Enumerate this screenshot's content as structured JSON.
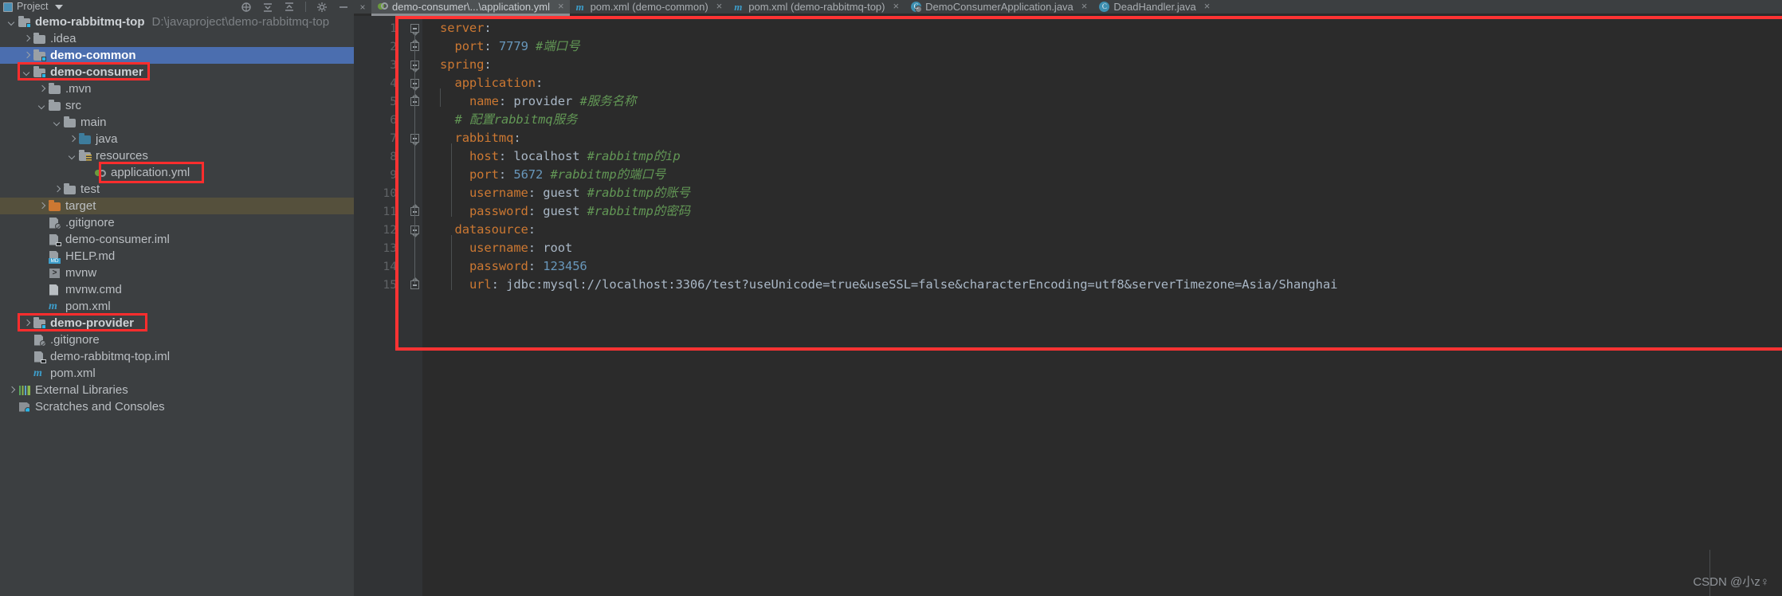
{
  "project_panel": {
    "title": "Project",
    "toolbar_icons": [
      "locate-icon",
      "collapse-all-icon",
      "expand-all-icon",
      "gear-icon",
      "minimize-icon"
    ],
    "tree": [
      {
        "label": "demo-rabbitmq-top",
        "path": "D:\\javaproject\\demo-rabbitmq-top",
        "icon": "module-folder-icon",
        "arrow": "down",
        "indent": 0,
        "bold": true
      },
      {
        "label": ".idea",
        "icon": "folder-icon",
        "arrow": "right",
        "indent": 1
      },
      {
        "label": "demo-common",
        "icon": "module-folder-icon",
        "arrow": "right",
        "indent": 1,
        "bold": true,
        "selected": true
      },
      {
        "label": "demo-consumer",
        "icon": "module-folder-icon",
        "arrow": "down",
        "indent": 1,
        "bold": true,
        "highlight": true
      },
      {
        "label": ".mvn",
        "icon": "folder-icon",
        "arrow": "right",
        "indent": 2
      },
      {
        "label": "src",
        "icon": "folder-icon",
        "arrow": "down",
        "indent": 2
      },
      {
        "label": "main",
        "icon": "folder-icon",
        "arrow": "down",
        "indent": 3
      },
      {
        "label": "java",
        "icon": "source-folder-icon",
        "arrow": "right",
        "indent": 4
      },
      {
        "label": "resources",
        "icon": "resource-folder-icon",
        "arrow": "down",
        "indent": 4
      },
      {
        "label": "application.yml",
        "icon": "yaml-file-icon",
        "arrow": "none",
        "indent": 5,
        "highlight": true
      },
      {
        "label": "test",
        "icon": "folder-icon",
        "arrow": "right",
        "indent": 3
      },
      {
        "label": "target",
        "icon": "excluded-folder-icon",
        "arrow": "right",
        "indent": 2,
        "target_row": true
      },
      {
        "label": ".gitignore",
        "icon": "gitignore-file-icon",
        "arrow": "none",
        "indent": 2
      },
      {
        "label": "demo-consumer.iml",
        "icon": "iml-file-icon",
        "arrow": "none",
        "indent": 2
      },
      {
        "label": "HELP.md",
        "icon": "markdown-file-icon",
        "arrow": "none",
        "indent": 2
      },
      {
        "label": "mvnw",
        "icon": "shell-script-icon",
        "arrow": "none",
        "indent": 2
      },
      {
        "label": "mvnw.cmd",
        "icon": "cmd-file-icon",
        "arrow": "none",
        "indent": 2
      },
      {
        "label": "pom.xml",
        "icon": "maven-file-icon",
        "arrow": "none",
        "indent": 2
      },
      {
        "label": "demo-provider",
        "icon": "module-folder-icon",
        "arrow": "right",
        "indent": 1,
        "bold": true,
        "highlight": true
      },
      {
        "label": ".gitignore",
        "icon": "gitignore-file-icon",
        "arrow": "none",
        "indent": 1
      },
      {
        "label": "demo-rabbitmq-top.iml",
        "icon": "iml-file-icon",
        "arrow": "none",
        "indent": 1
      },
      {
        "label": "pom.xml",
        "icon": "maven-file-icon",
        "arrow": "none",
        "indent": 1
      },
      {
        "label": "External Libraries",
        "icon": "external-libraries-icon",
        "arrow": "right",
        "indent": 0
      },
      {
        "label": "Scratches and Consoles",
        "icon": "scratches-icon",
        "arrow": "none",
        "indent": 0
      }
    ]
  },
  "editor": {
    "tabs": [
      {
        "label": "demo-consumer\\...\\application.yml",
        "icon": "yaml-file-icon",
        "active": true,
        "close": "×"
      },
      {
        "label": "pom.xml (demo-common)",
        "icon": "maven-file-icon",
        "active": false,
        "close": "×"
      },
      {
        "label": "pom.xml (demo-rabbitmq-top)",
        "icon": "maven-file-icon",
        "active": false,
        "close": "×"
      },
      {
        "label": "DemoConsumerApplication.java",
        "icon": "java-runnable-icon",
        "active": false,
        "close": "×"
      },
      {
        "label": "DeadHandler.java",
        "icon": "java-class-icon",
        "active": false,
        "close": "×"
      }
    ],
    "tab_close_left": "×",
    "line_numbers": [
      "1",
      "2",
      "3",
      "4",
      "5",
      "6",
      "7",
      "8",
      "9",
      "10",
      "11",
      "12",
      "13",
      "14",
      "15"
    ],
    "code_lines": [
      {
        "n": 1,
        "tokens": [
          {
            "t": "server",
            "c": "k"
          },
          {
            "t": ":",
            "c": "p"
          }
        ]
      },
      {
        "n": 2,
        "tokens": [
          {
            "t": "  ",
            "c": "p"
          },
          {
            "t": "port",
            "c": "k"
          },
          {
            "t": ": ",
            "c": "p"
          },
          {
            "t": "7779",
            "c": "n"
          },
          {
            "t": " ",
            "c": "p"
          },
          {
            "t": "#端口号",
            "c": "c"
          }
        ]
      },
      {
        "n": 3,
        "tokens": [
          {
            "t": "spring",
            "c": "k"
          },
          {
            "t": ":",
            "c": "p"
          }
        ]
      },
      {
        "n": 4,
        "tokens": [
          {
            "t": "  ",
            "c": "p"
          },
          {
            "t": "application",
            "c": "k"
          },
          {
            "t": ":",
            "c": "p"
          }
        ]
      },
      {
        "n": 5,
        "tokens": [
          {
            "t": "    ",
            "c": "p"
          },
          {
            "t": "name",
            "c": "k"
          },
          {
            "t": ": ",
            "c": "p"
          },
          {
            "t": "provider",
            "c": "p"
          },
          {
            "t": " ",
            "c": "p"
          },
          {
            "t": "#服务名称",
            "c": "c"
          }
        ]
      },
      {
        "n": 6,
        "tokens": [
          {
            "t": "  ",
            "c": "p"
          },
          {
            "t": "# 配置rabbitmq服务",
            "c": "c"
          }
        ]
      },
      {
        "n": 7,
        "tokens": [
          {
            "t": "  ",
            "c": "p"
          },
          {
            "t": "rabbitmq",
            "c": "k"
          },
          {
            "t": ":",
            "c": "p"
          }
        ]
      },
      {
        "n": 8,
        "tokens": [
          {
            "t": "    ",
            "c": "p"
          },
          {
            "t": "host",
            "c": "k"
          },
          {
            "t": ": ",
            "c": "p"
          },
          {
            "t": "localhost",
            "c": "p"
          },
          {
            "t": " ",
            "c": "p"
          },
          {
            "t": "#rabbitmp的ip",
            "c": "c"
          }
        ]
      },
      {
        "n": 9,
        "tokens": [
          {
            "t": "    ",
            "c": "p"
          },
          {
            "t": "port",
            "c": "k"
          },
          {
            "t": ": ",
            "c": "p"
          },
          {
            "t": "5672",
            "c": "n"
          },
          {
            "t": " ",
            "c": "p"
          },
          {
            "t": "#rabbitmp的端口号",
            "c": "c"
          }
        ]
      },
      {
        "n": 10,
        "tokens": [
          {
            "t": "    ",
            "c": "p"
          },
          {
            "t": "username",
            "c": "k"
          },
          {
            "t": ": ",
            "c": "p"
          },
          {
            "t": "guest",
            "c": "p"
          },
          {
            "t": " ",
            "c": "p"
          },
          {
            "t": "#rabbitmp的账号",
            "c": "c"
          }
        ]
      },
      {
        "n": 11,
        "tokens": [
          {
            "t": "    ",
            "c": "p"
          },
          {
            "t": "password",
            "c": "k"
          },
          {
            "t": ": ",
            "c": "p"
          },
          {
            "t": "guest",
            "c": "p"
          },
          {
            "t": " ",
            "c": "p"
          },
          {
            "t": "#rabbitmp的密码",
            "c": "c"
          }
        ]
      },
      {
        "n": 12,
        "tokens": [
          {
            "t": "  ",
            "c": "p"
          },
          {
            "t": "datasource",
            "c": "k"
          },
          {
            "t": ":",
            "c": "p"
          }
        ]
      },
      {
        "n": 13,
        "tokens": [
          {
            "t": "    ",
            "c": "p"
          },
          {
            "t": "username",
            "c": "k"
          },
          {
            "t": ": ",
            "c": "p"
          },
          {
            "t": "root",
            "c": "p"
          }
        ]
      },
      {
        "n": 14,
        "tokens": [
          {
            "t": "    ",
            "c": "p"
          },
          {
            "t": "password",
            "c": "k"
          },
          {
            "t": ": ",
            "c": "p"
          },
          {
            "t": "123456",
            "c": "n"
          }
        ]
      },
      {
        "n": 15,
        "tokens": [
          {
            "t": "    ",
            "c": "p"
          },
          {
            "t": "url",
            "c": "k"
          },
          {
            "t": ": ",
            "c": "p"
          },
          {
            "t": "jdbc:mysql://localhost:3306/test?useUnicode=true&useSSL=false&characterEncoding=utf8&serverTimezone=Asia/Shanghai",
            "c": "p"
          }
        ]
      }
    ]
  },
  "watermark": "CSDN @小z♀",
  "colors": {
    "annotation_red": "#ff2d2d",
    "selection_blue": "#4b6eaf",
    "target_row": "#55503c",
    "editor_bg": "#2b2b2b",
    "panel_bg": "#3c3f41",
    "key_orange": "#cc7832",
    "number_blue": "#6897bb",
    "comment_green": "#629755",
    "plain_text": "#a9b7c6"
  }
}
